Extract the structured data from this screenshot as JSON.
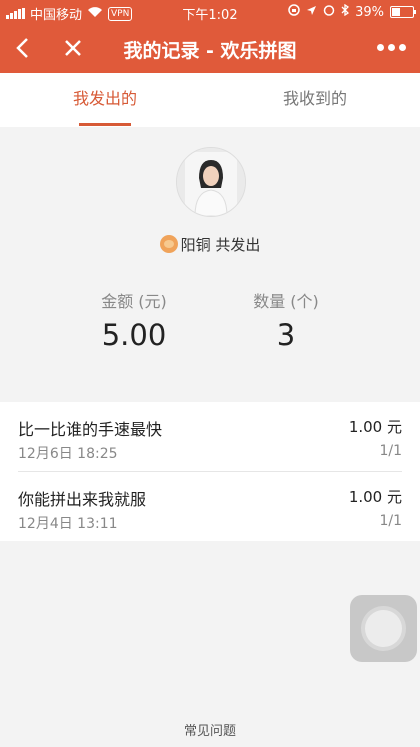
{
  "status_bar": {
    "carrier": "中国移动",
    "vpn": "VPN",
    "time": "下午1:02",
    "battery": "39%"
  },
  "nav": {
    "title": "我的记录 - 欢乐拼图",
    "back_icon": "chevron-left-icon",
    "close_icon": "close-icon",
    "more_icon": "more-dots-icon"
  },
  "colors": {
    "brand": "#e05a3a",
    "accent": "#d75a36"
  },
  "tabs": [
    {
      "label": "我发出的",
      "active": true
    },
    {
      "label": "我收到的",
      "active": false
    }
  ],
  "profile": {
    "name": "阳铜",
    "suffix": "共发出"
  },
  "stats": {
    "amount_label": "金额 (元)",
    "amount_value": "5.00",
    "count_label": "数量 (个)",
    "count_value": "3"
  },
  "records": [
    {
      "title": "比一比谁的手速最快",
      "time": "12月6日 18:25",
      "amount": "1.00 元",
      "count": "1/1"
    },
    {
      "title": "你能拼出来我就服",
      "time": "12月4日 13:11",
      "amount": "1.00 元",
      "count": "1/1"
    }
  ],
  "footer": {
    "faq": "常见问题"
  }
}
